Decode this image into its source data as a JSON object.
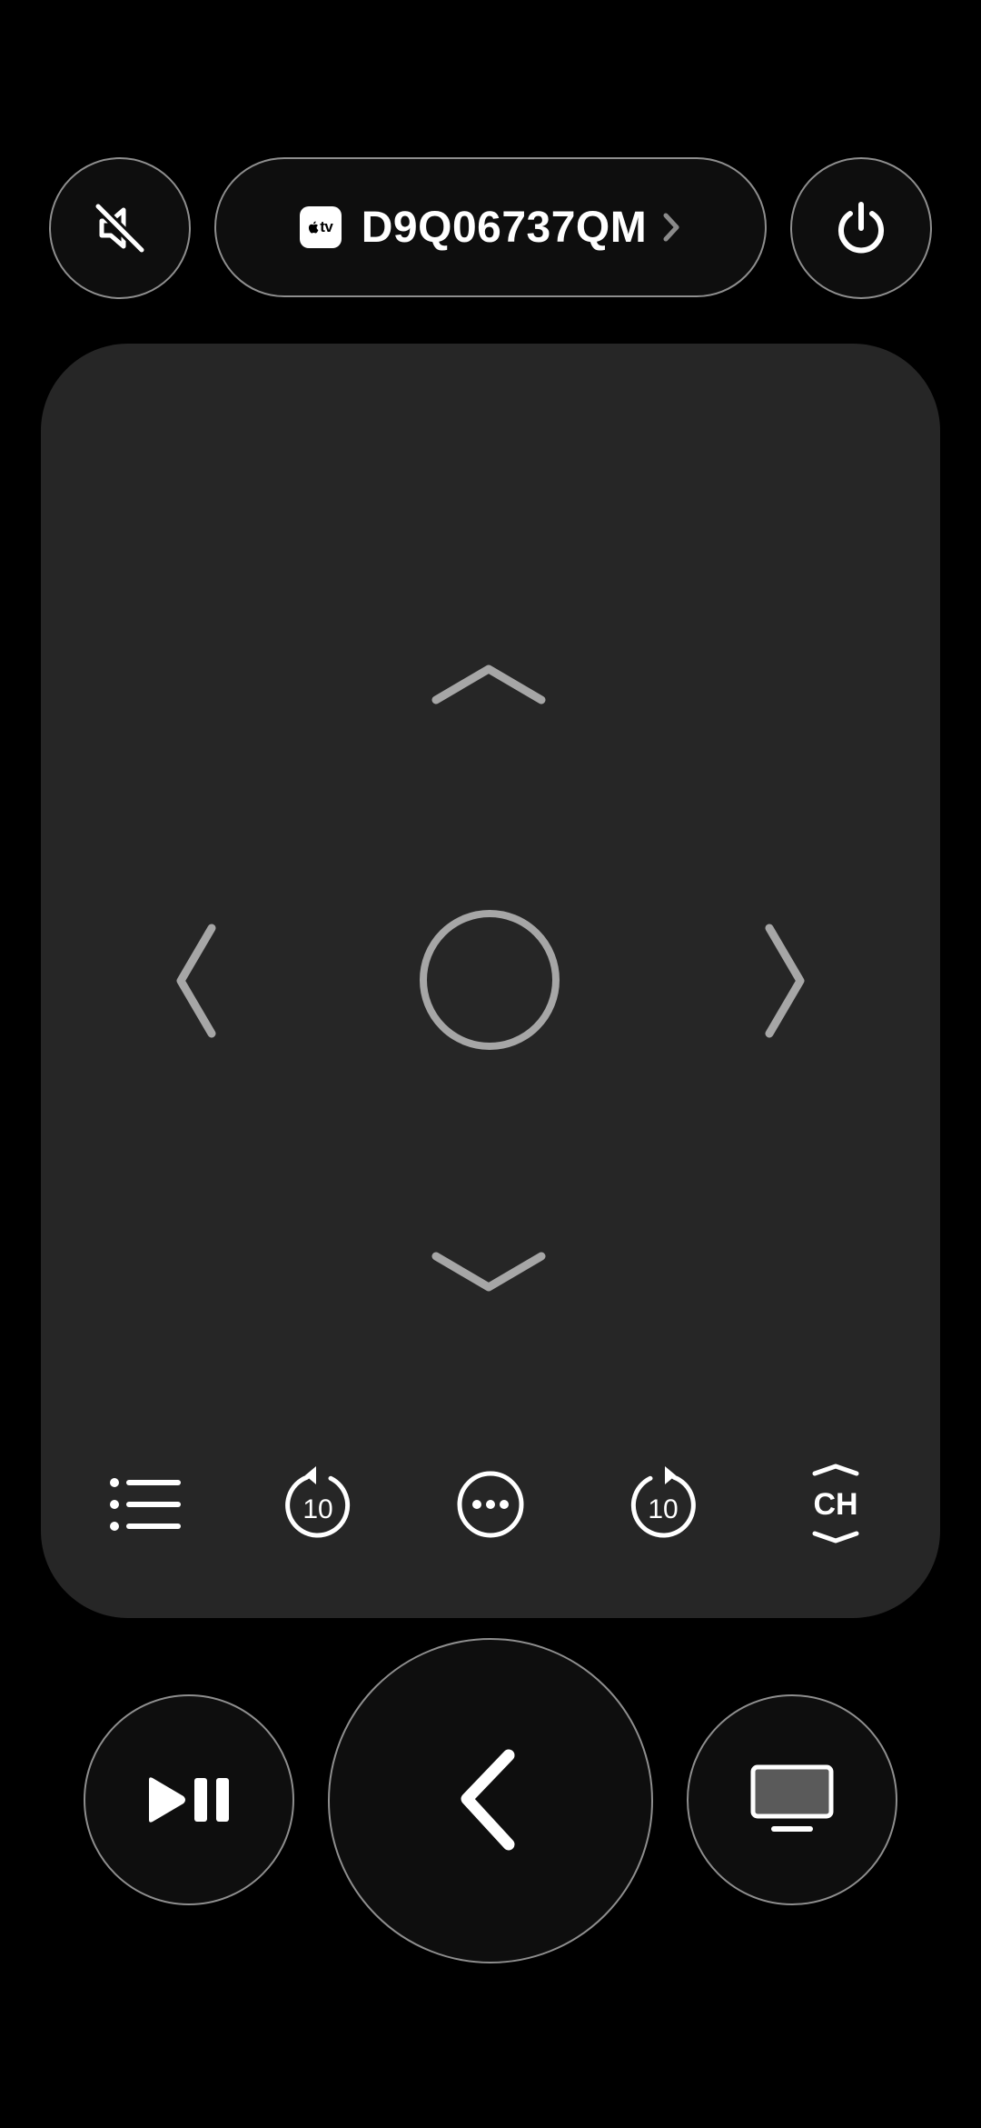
{
  "header": {
    "mute_icon": "speaker-slash-icon",
    "power_icon": "power-icon",
    "device": {
      "badge_icon": "apple-tv-icon",
      "badge_text": "tv",
      "name": "D9Q06737QM",
      "chevron_icon": "chevron-right-icon"
    }
  },
  "touchpad": {
    "dpad": {
      "up_icon": "chevron-up-icon",
      "down_icon": "chevron-down-icon",
      "left_icon": "chevron-left-icon",
      "right_icon": "chevron-right-icon",
      "select_icon": "select-circle-icon"
    },
    "controls": {
      "menu_icon": "list-icon",
      "skip_back_label": "10",
      "skip_back_icon": "skip-back-10-icon",
      "more_icon": "ellipsis-circle-icon",
      "skip_forward_label": "10",
      "skip_forward_icon": "skip-forward-10-icon",
      "channel_label": "CH",
      "channel_icon": "channel-up-down-icon"
    }
  },
  "bottom": {
    "play_pause_icon": "play-pause-icon",
    "back_icon": "chevron-left-icon",
    "tv_icon": "tv-icon"
  },
  "colors": {
    "background": "#000000",
    "touchpad": "#262626",
    "button_border": "#8e8e8e",
    "dpad_mark": "#a6a6a6",
    "icon": "#ffffff"
  }
}
